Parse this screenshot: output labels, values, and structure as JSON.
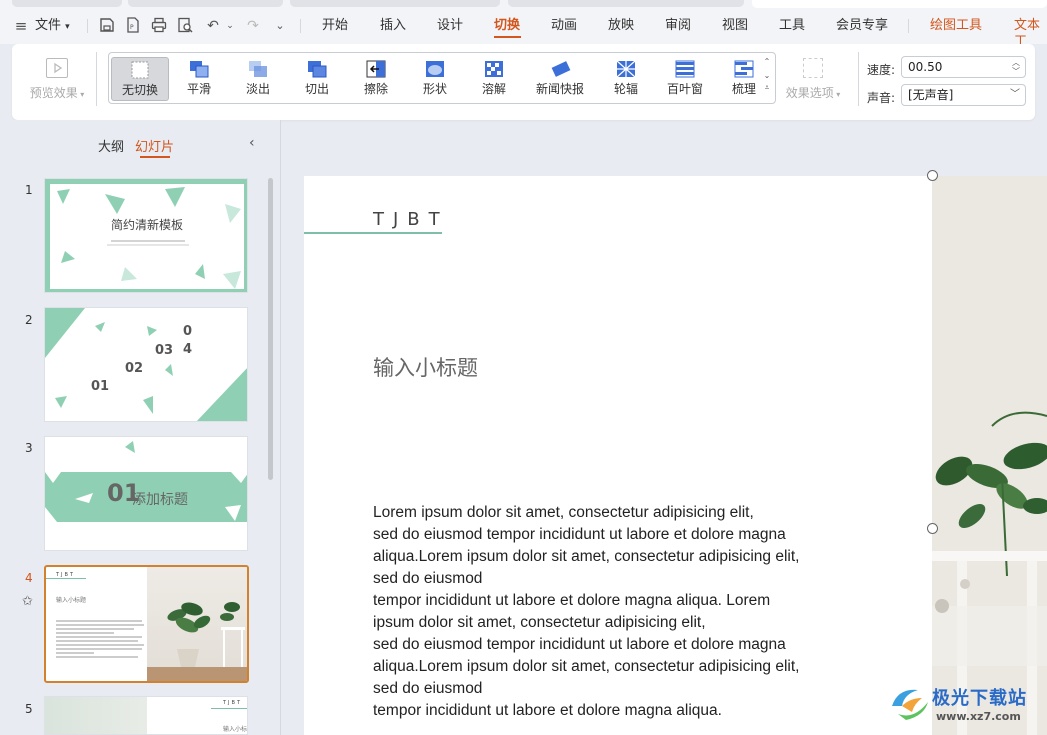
{
  "menu": {
    "file": "文件",
    "tabs": [
      "开始",
      "插入",
      "设计",
      "切换",
      "动画",
      "放映",
      "审阅",
      "视图",
      "工具",
      "会员专享",
      "绘图工具",
      "文本工"
    ],
    "active_tab": "切换"
  },
  "ribbon": {
    "preview": "预览效果",
    "transitions": [
      "无切换",
      "平滑",
      "淡出",
      "切出",
      "擦除",
      "形状",
      "溶解",
      "新闻快报",
      "轮辐",
      "百叶窗",
      "梳理"
    ],
    "selected": "无切换",
    "effect_options": "效果选项",
    "speed_label": "速度:",
    "speed_value": "00.50",
    "sound_label": "声音:",
    "sound_value": "[无声音]"
  },
  "panel": {
    "tab_outline": "大纲",
    "tab_slides": "幻灯片",
    "slides": [
      {
        "num": "1",
        "title": "简约清新模板"
      },
      {
        "num": "2",
        "items": [
          "0",
          "4",
          "03",
          "02",
          "01"
        ]
      },
      {
        "num": "3",
        "num_text": "01",
        "title": "添加标题"
      },
      {
        "num": "4",
        "title": "TJBT",
        "subtitle": "输入小标题"
      },
      {
        "num": "5",
        "title": "TJBT",
        "subtitle": "输入小标题"
      }
    ],
    "current": "4"
  },
  "slide": {
    "title": "TJBT",
    "subtitle": "输入小标题",
    "body_lines": [
      "Lorem ipsum dolor sit amet, consectetur adipisicing elit,",
      "sed do eiusmod tempor incididunt ut labore et dolore magna",
      "aliqua.Lorem ipsum dolor sit amet, consectetur adipisicing elit,",
      "sed do eiusmod",
      "tempor incididunt ut labore et dolore magna aliqua. Lorem",
      "ipsum dolor sit amet, consectetur adipisicing elit,",
      "sed do eiusmod tempor incididunt ut labore et dolore magna",
      "aliqua.Lorem ipsum dolor sit amet, consectetur adipisicing elit,",
      "sed do eiusmod",
      "tempor incididunt ut labore et dolore magna aliqua."
    ]
  },
  "watermark": {
    "name": "极光下载站",
    "url": "www.xz7.com"
  },
  "colors": {
    "accent": "#d2561d",
    "mint": "#8fd0b4",
    "selected_border": "#d2822e"
  }
}
